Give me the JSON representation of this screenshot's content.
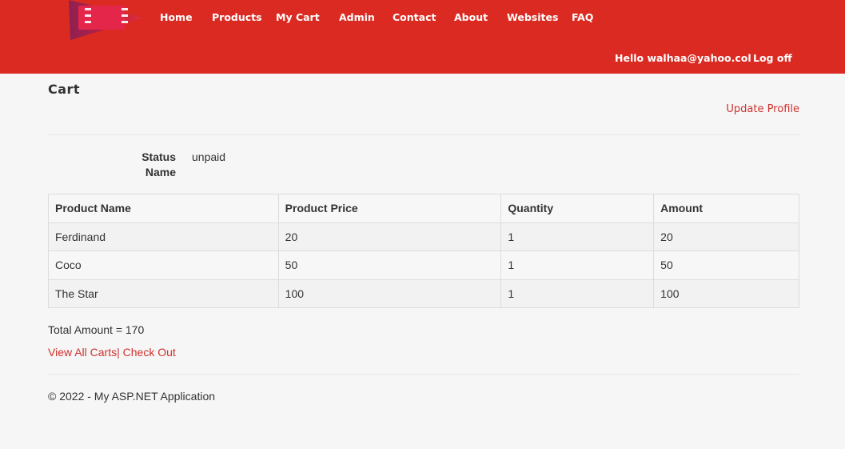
{
  "nav": {
    "items": [
      {
        "label": "Home"
      },
      {
        "label": "Products"
      },
      {
        "label": "My Cart"
      },
      {
        "label": "Admin"
      },
      {
        "label": "Contact"
      },
      {
        "label": "About"
      },
      {
        "label": "Websites"
      },
      {
        "label": "FAQ"
      }
    ],
    "greeting": "Hello walhaa@yahoo.col",
    "logoff": "Log off"
  },
  "colors": {
    "brand": "#db2a22",
    "link": "#d0312d"
  },
  "page": {
    "title": "Cart",
    "update_profile": "Update Profile",
    "status_label": "Status Name",
    "status_value": "unpaid"
  },
  "table": {
    "headers": [
      "Product Name",
      "Product Price",
      "Quantity",
      "Amount"
    ],
    "rows": [
      [
        "Ferdinand",
        "20",
        "1",
        "20"
      ],
      [
        "Coco",
        "50",
        "1",
        "50"
      ],
      [
        "The Star",
        "100",
        "1",
        "100"
      ]
    ]
  },
  "summary": {
    "total": "Total Amount = 170",
    "view_all": "View All Carts",
    "separator": "|",
    "checkout": "Check Out"
  },
  "footer": {
    "text": "© 2022 - My ASP.NET Application"
  }
}
